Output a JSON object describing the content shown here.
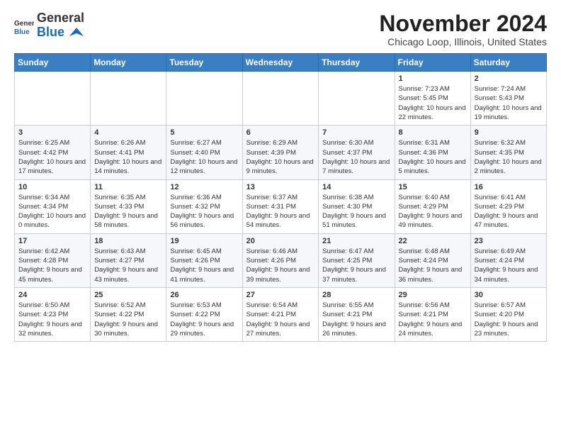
{
  "logo": {
    "general": "General",
    "blue": "Blue"
  },
  "header": {
    "month": "November 2024",
    "location": "Chicago Loop, Illinois, United States"
  },
  "weekdays": [
    "Sunday",
    "Monday",
    "Tuesday",
    "Wednesday",
    "Thursday",
    "Friday",
    "Saturday"
  ],
  "weeks": [
    [
      {
        "day": "",
        "info": ""
      },
      {
        "day": "",
        "info": ""
      },
      {
        "day": "",
        "info": ""
      },
      {
        "day": "",
        "info": ""
      },
      {
        "day": "",
        "info": ""
      },
      {
        "day": "1",
        "info": "Sunrise: 7:23 AM\nSunset: 5:45 PM\nDaylight: 10 hours and 22 minutes."
      },
      {
        "day": "2",
        "info": "Sunrise: 7:24 AM\nSunset: 5:43 PM\nDaylight: 10 hours and 19 minutes."
      }
    ],
    [
      {
        "day": "3",
        "info": "Sunrise: 6:25 AM\nSunset: 4:42 PM\nDaylight: 10 hours and 17 minutes."
      },
      {
        "day": "4",
        "info": "Sunrise: 6:26 AM\nSunset: 4:41 PM\nDaylight: 10 hours and 14 minutes."
      },
      {
        "day": "5",
        "info": "Sunrise: 6:27 AM\nSunset: 4:40 PM\nDaylight: 10 hours and 12 minutes."
      },
      {
        "day": "6",
        "info": "Sunrise: 6:29 AM\nSunset: 4:39 PM\nDaylight: 10 hours and 9 minutes."
      },
      {
        "day": "7",
        "info": "Sunrise: 6:30 AM\nSunset: 4:37 PM\nDaylight: 10 hours and 7 minutes."
      },
      {
        "day": "8",
        "info": "Sunrise: 6:31 AM\nSunset: 4:36 PM\nDaylight: 10 hours and 5 minutes."
      },
      {
        "day": "9",
        "info": "Sunrise: 6:32 AM\nSunset: 4:35 PM\nDaylight: 10 hours and 2 minutes."
      }
    ],
    [
      {
        "day": "10",
        "info": "Sunrise: 6:34 AM\nSunset: 4:34 PM\nDaylight: 10 hours and 0 minutes."
      },
      {
        "day": "11",
        "info": "Sunrise: 6:35 AM\nSunset: 4:33 PM\nDaylight: 9 hours and 58 minutes."
      },
      {
        "day": "12",
        "info": "Sunrise: 6:36 AM\nSunset: 4:32 PM\nDaylight: 9 hours and 56 minutes."
      },
      {
        "day": "13",
        "info": "Sunrise: 6:37 AM\nSunset: 4:31 PM\nDaylight: 9 hours and 54 minutes."
      },
      {
        "day": "14",
        "info": "Sunrise: 6:38 AM\nSunset: 4:30 PM\nDaylight: 9 hours and 51 minutes."
      },
      {
        "day": "15",
        "info": "Sunrise: 6:40 AM\nSunset: 4:29 PM\nDaylight: 9 hours and 49 minutes."
      },
      {
        "day": "16",
        "info": "Sunrise: 6:41 AM\nSunset: 4:29 PM\nDaylight: 9 hours and 47 minutes."
      }
    ],
    [
      {
        "day": "17",
        "info": "Sunrise: 6:42 AM\nSunset: 4:28 PM\nDaylight: 9 hours and 45 minutes."
      },
      {
        "day": "18",
        "info": "Sunrise: 6:43 AM\nSunset: 4:27 PM\nDaylight: 9 hours and 43 minutes."
      },
      {
        "day": "19",
        "info": "Sunrise: 6:45 AM\nSunset: 4:26 PM\nDaylight: 9 hours and 41 minutes."
      },
      {
        "day": "20",
        "info": "Sunrise: 6:46 AM\nSunset: 4:26 PM\nDaylight: 9 hours and 39 minutes."
      },
      {
        "day": "21",
        "info": "Sunrise: 6:47 AM\nSunset: 4:25 PM\nDaylight: 9 hours and 37 minutes."
      },
      {
        "day": "22",
        "info": "Sunrise: 6:48 AM\nSunset: 4:24 PM\nDaylight: 9 hours and 36 minutes."
      },
      {
        "day": "23",
        "info": "Sunrise: 6:49 AM\nSunset: 4:24 PM\nDaylight: 9 hours and 34 minutes."
      }
    ],
    [
      {
        "day": "24",
        "info": "Sunrise: 6:50 AM\nSunset: 4:23 PM\nDaylight: 9 hours and 32 minutes."
      },
      {
        "day": "25",
        "info": "Sunrise: 6:52 AM\nSunset: 4:22 PM\nDaylight: 9 hours and 30 minutes."
      },
      {
        "day": "26",
        "info": "Sunrise: 6:53 AM\nSunset: 4:22 PM\nDaylight: 9 hours and 29 minutes."
      },
      {
        "day": "27",
        "info": "Sunrise: 6:54 AM\nSunset: 4:21 PM\nDaylight: 9 hours and 27 minutes."
      },
      {
        "day": "28",
        "info": "Sunrise: 6:55 AM\nSunset: 4:21 PM\nDaylight: 9 hours and 26 minutes."
      },
      {
        "day": "29",
        "info": "Sunrise: 6:56 AM\nSunset: 4:21 PM\nDaylight: 9 hours and 24 minutes."
      },
      {
        "day": "30",
        "info": "Sunrise: 6:57 AM\nSunset: 4:20 PM\nDaylight: 9 hours and 23 minutes."
      }
    ]
  ]
}
